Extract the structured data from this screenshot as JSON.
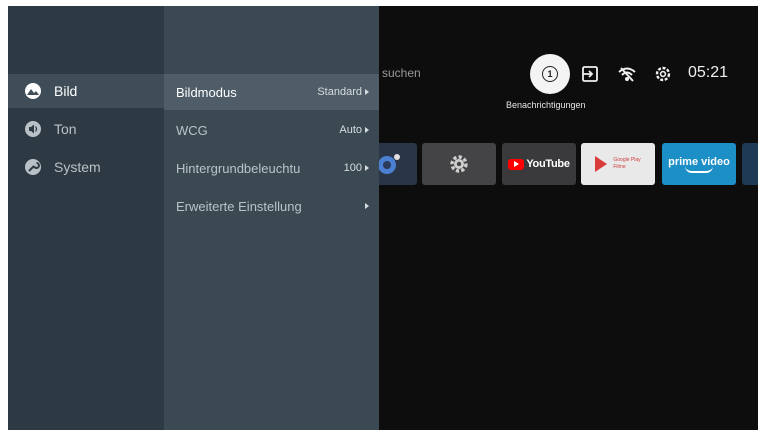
{
  "home": {
    "search_text": "suchen",
    "notification_button": {
      "badge": "1",
      "label": "Benachrichtigungen"
    },
    "clock": "05:21",
    "status_icons": [
      "input-icon",
      "wifi-off-icon",
      "settings-gear-icon"
    ],
    "apps": [
      {
        "name": "game-controller-app",
        "label": ""
      },
      {
        "name": "settings-app",
        "label": ""
      },
      {
        "name": "youtube-app",
        "label": "YouTube"
      },
      {
        "name": "google-play-filme-app",
        "label": "Google Play",
        "sublabel": "Filme"
      },
      {
        "name": "prime-video-app",
        "label": "prime video"
      }
    ]
  },
  "sidebar": {
    "items": [
      {
        "label": "Bild",
        "icon": "picture-mountain-icon",
        "active": true
      },
      {
        "label": "Ton",
        "icon": "speaker-icon",
        "active": false
      },
      {
        "label": "System",
        "icon": "wrench-icon",
        "active": false
      }
    ]
  },
  "submenu": {
    "items": [
      {
        "label": "Bildmodus",
        "value": "Standard",
        "active": true
      },
      {
        "label": "WCG",
        "value": "Auto",
        "active": false
      },
      {
        "label": "Hintergrundbeleuchtu",
        "value": "100",
        "active": false
      },
      {
        "label": "Erweiterte Einstellung",
        "value": "",
        "active": false
      }
    ]
  },
  "colors": {
    "sidebar_bg": "#2e3a43",
    "submenu_bg": "#3b4952",
    "highlight": "#4e5d67",
    "prime_blue": "#1d8fc7",
    "youtube_red": "#ff0000"
  }
}
